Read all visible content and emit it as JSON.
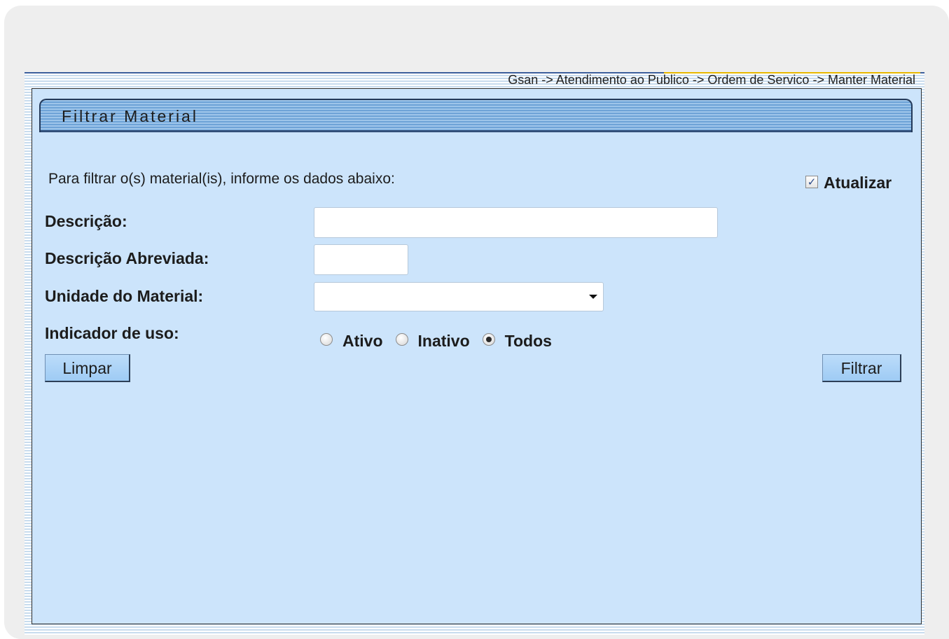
{
  "breadcrumb": "Gsan -> Atendimento ao Publico -> Ordem de Servico -> Manter Material",
  "tab_title": "Filtrar Material",
  "instruction": "Para filtrar o(s) material(is), informe os dados abaixo:",
  "atualizar": {
    "label": "Atualizar",
    "checked": true,
    "check_glyph": "✓"
  },
  "fields": {
    "descricao": {
      "label": "Descrição:",
      "value": ""
    },
    "descricao_abreviada": {
      "label": "Descrição Abreviada:",
      "value": ""
    },
    "unidade_material": {
      "label": "Unidade do Material:",
      "selected": ""
    },
    "indicador_uso": {
      "label": "Indicador de uso:",
      "options": [
        {
          "label": "Ativo",
          "checked": false
        },
        {
          "label": "Inativo",
          "checked": false
        },
        {
          "label": "Todos",
          "checked": true
        }
      ]
    }
  },
  "buttons": {
    "limpar": "Limpar",
    "filtrar": "Filtrar"
  },
  "colors": {
    "panel_bg": "#cce4fb",
    "header_blue": "#6ea3d7",
    "breadcrumb_accent": "#e8b800"
  }
}
